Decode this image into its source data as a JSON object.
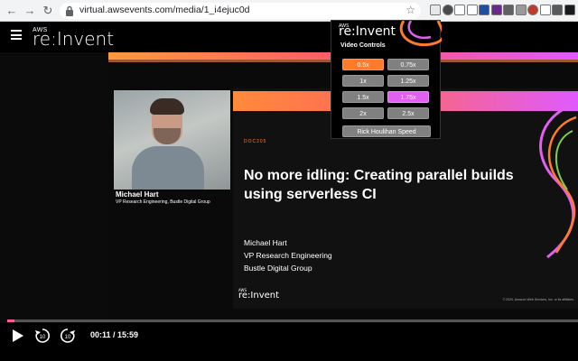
{
  "browser": {
    "url": "virtual.awsevents.com/media/1_i4ejuc0d",
    "back_glyph": "←",
    "forward_glyph": "→",
    "reload_glyph": "↻",
    "star_glyph": "☆",
    "extension_colors": [
      "#e8e8e8",
      "#4a4a4a",
      "#ffffff",
      "#ffffff",
      "#1e4fa0",
      "#6a2a8a",
      "#606060",
      "#9a9a9a",
      "#c0392b",
      "#ffffff",
      "#5a5a5a",
      "#1a1a1a"
    ]
  },
  "header": {
    "logo_small": "AWS",
    "logo_main": "re:Invent"
  },
  "speaker": {
    "name": "Michael Hart",
    "title": "VP Research Engineering, Bustle Digital Group"
  },
  "slide": {
    "code": "DOC205",
    "title": "No more idling: Creating parallel builds using serverless CI",
    "lines": [
      "Michael Hart",
      "VP Research Engineering",
      "Bustle Digital Group"
    ],
    "logo_small": "AWS",
    "logo_main": "re:Invent",
    "copyright": "© 2020, Amazon Web Services, Inc. or its affiliates."
  },
  "player": {
    "time_display": "00:11 / 15:59",
    "progress_fraction": 0.012,
    "skip_back_label": "10",
    "skip_forward_label": "10"
  },
  "popup": {
    "logo_small": "AWS",
    "logo_main": "re:Invent",
    "heading": "Video Controls",
    "speeds": [
      "0.5x",
      "0.75x",
      "1x",
      "1.25x",
      "1.5x",
      "1.75x",
      "2x",
      "2.5x"
    ],
    "active_speed": "0.5x",
    "highlighted_speed": "1.75x",
    "special": "Rick Houlihan Speed"
  },
  "colors": {
    "accent_orange": "#ff7a2a",
    "accent_pink": "#e060f0",
    "progress": "#ff5a9a"
  }
}
